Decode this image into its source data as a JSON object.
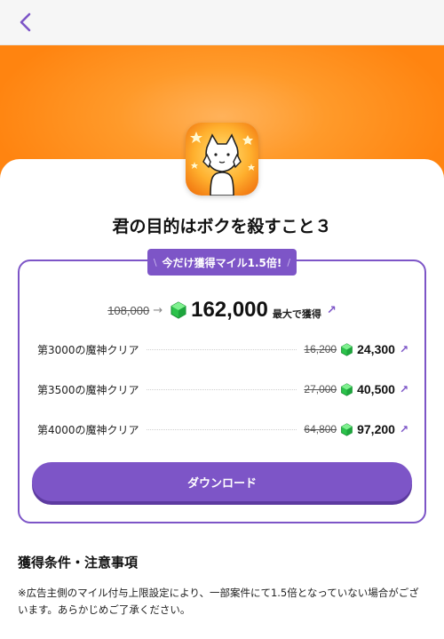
{
  "nav": {
    "back_icon": "chevron-left-icon"
  },
  "app": {
    "title": "君の目的はボクを殺すこと３",
    "icon": "cat-character-app-icon"
  },
  "colors": {
    "accent": "#7d55c7",
    "hero_orange": "#ff8a18",
    "gem_green": "#2bc24a"
  },
  "offer": {
    "badge_left": "\\",
    "badge": "今だけ獲得マイル1.5倍!",
    "badge_right": "/",
    "total_original": "108,000",
    "total_boosted": "162,000",
    "total_suffix": "最大で獲得"
  },
  "missions": [
    {
      "label": "第3000の魔神クリア",
      "original": "16,200",
      "boosted": "24,300"
    },
    {
      "label": "第3500の魔神クリア",
      "original": "27,000",
      "boosted": "40,500"
    },
    {
      "label": "第4000の魔神クリア",
      "original": "64,800",
      "boosted": "97,200"
    }
  ],
  "download_label": "ダウンロード",
  "conditions": {
    "title": "獲得条件・注意事項",
    "text": "※広告主側のマイル付与上限設定により、一部案件にて1.5倍となっていない場合がございます。あらかじめご了承ください。"
  }
}
